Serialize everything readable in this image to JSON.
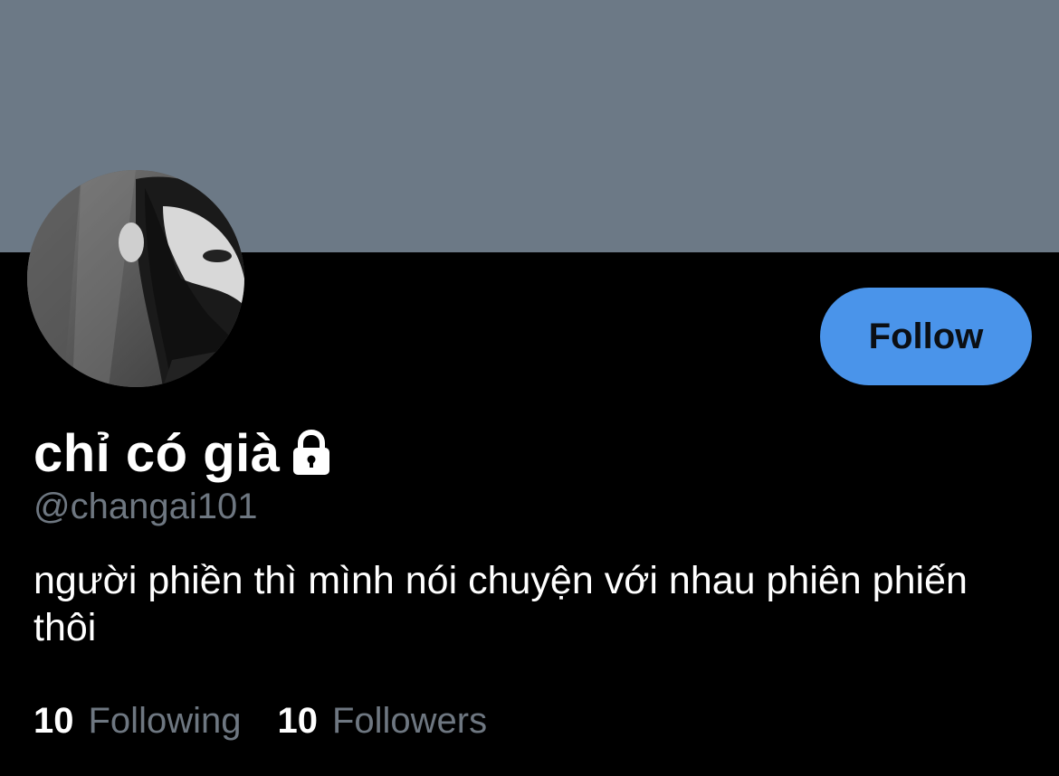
{
  "profile": {
    "display_name": "chỉ có già",
    "handle": "@changai101",
    "bio": "người phiền thì mình nói chuyện với nhau phiên phiến thôi",
    "locked_icon": "lock-icon",
    "avatar_icon": "profile-photo"
  },
  "actions": {
    "follow_label": "Follow"
  },
  "stats": {
    "following_count": "10",
    "following_label": "Following",
    "followers_count": "10",
    "followers_label": "Followers"
  },
  "colors": {
    "banner": "#6c7986",
    "background": "#000000",
    "follow_button": "#4a94ea",
    "secondary_text": "#6e7781"
  }
}
